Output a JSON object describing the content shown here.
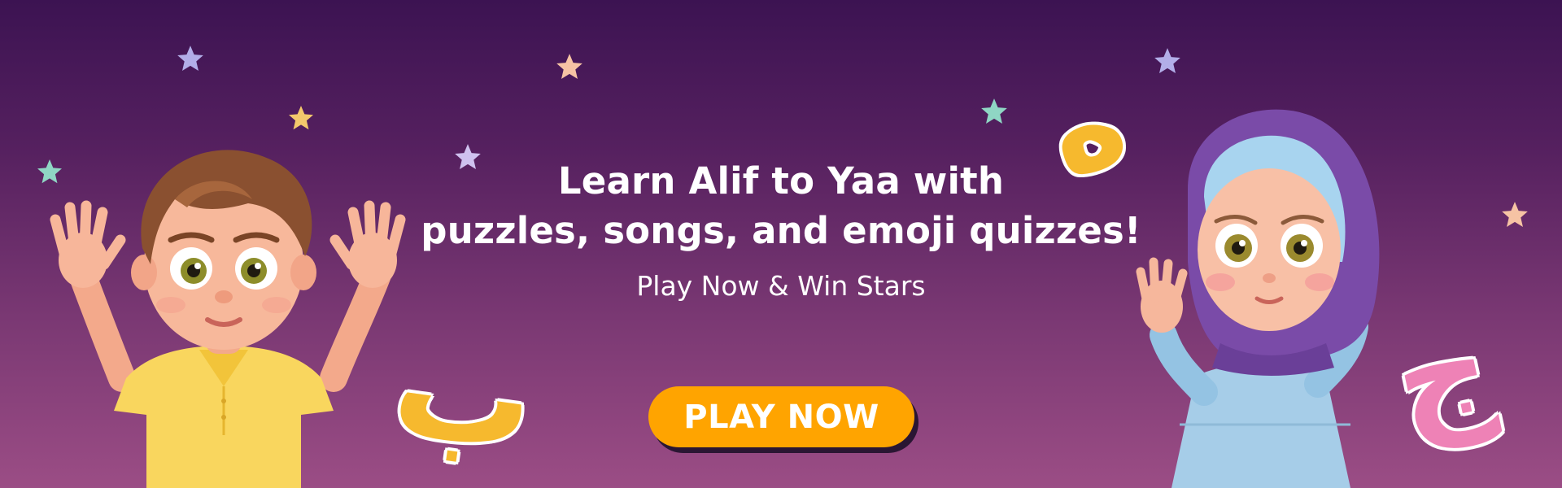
{
  "banner": {
    "headline_line1": "Learn Alif to Yaa with",
    "headline_line2": "puzzles, songs, and emoji quizzes!",
    "subtitle": "Play Now & Win Stars",
    "cta_label": "PLAY NOW"
  },
  "characters": [
    {
      "name": "boy",
      "description": "cartoon boy in yellow polo waving both hands"
    },
    {
      "name": "girl",
      "description": "cartoon girl in purple hijab waving"
    }
  ],
  "letters": [
    "ب",
    "ه",
    "ج"
  ],
  "colors": {
    "bg_top": "#3c1352",
    "bg_bottom": "#9b4d85",
    "cta": "#ffa400",
    "cta_shadow": "#2a1633",
    "text": "#ffffff",
    "letter_gold": "#f6b92e",
    "letter_pink": "#ee82b6"
  }
}
